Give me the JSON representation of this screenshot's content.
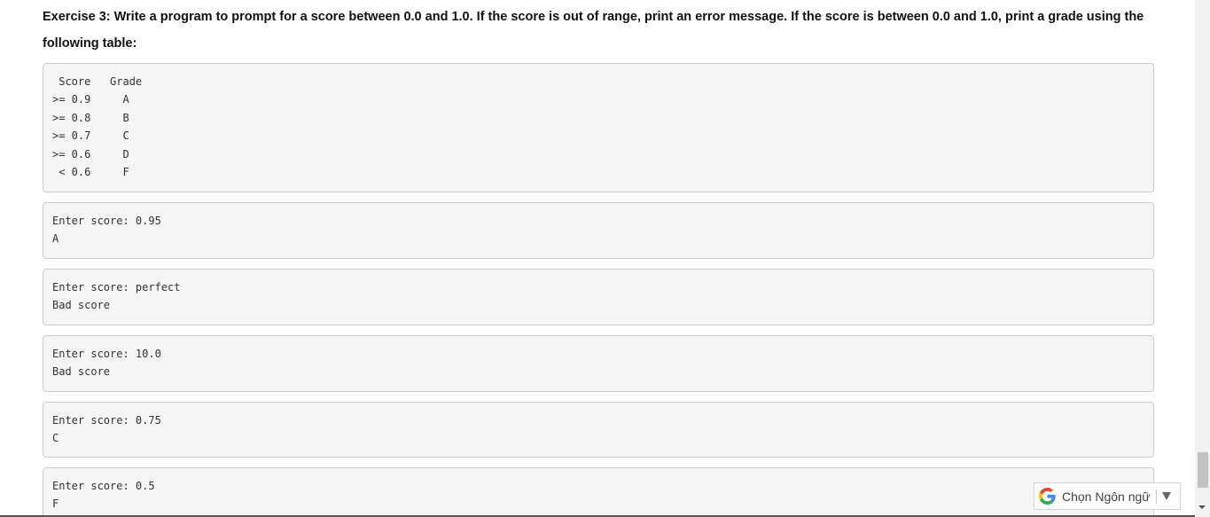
{
  "exercise": {
    "text": "Exercise 3: Write a program to prompt for a score between 0.0 and 1.0. If the score is out of range, print an error message. If the score is between 0.0 and 1.0, print a grade using the following table:"
  },
  "grade_table": {
    "lines": [
      " Score   Grade",
      ">= 0.9     A",
      ">= 0.8     B",
      ">= 0.7     C",
      ">= 0.6     D",
      " < 0.6     F"
    ]
  },
  "sample_runs": [
    {
      "prompt": "Enter score: 0.95",
      "output": "A"
    },
    {
      "prompt": "Enter score: perfect",
      "output": "Bad score"
    },
    {
      "prompt": "Enter score: 10.0",
      "output": "Bad score"
    },
    {
      "prompt": "Enter score: 0.75",
      "output": "C"
    },
    {
      "prompt": "Enter score: 0.5",
      "output": "F"
    }
  ],
  "translate_widget": {
    "label": "Chọn Ngôn ngữ",
    "icon": "google-g-icon",
    "brand_colors": [
      "#4285F4",
      "#EA4335",
      "#FBBC05",
      "#34A853"
    ]
  },
  "colors": {
    "code_background": "#f5f5f5",
    "code_border": "#cccccc",
    "text": "#222222"
  }
}
